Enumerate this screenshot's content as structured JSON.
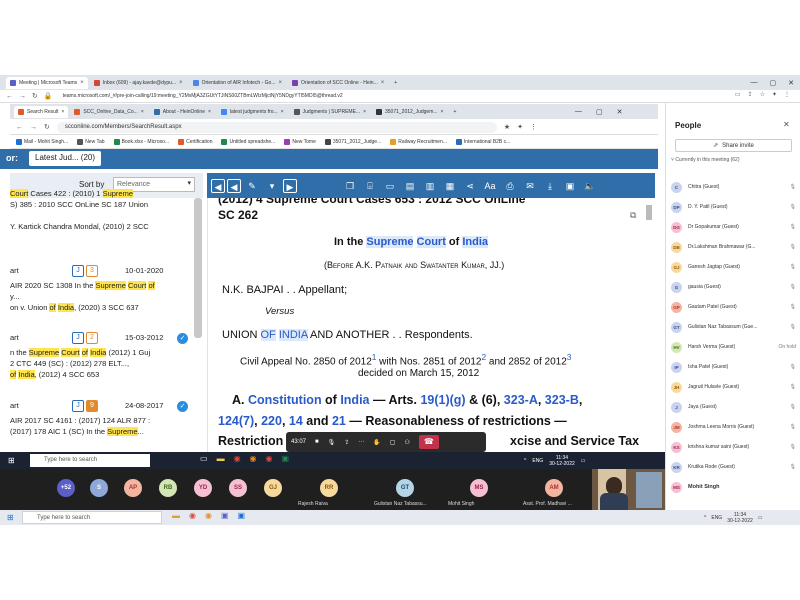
{
  "outer_tabs": [
    {
      "label": "Meeting | Microsoft Teams",
      "color": "#5b5fc7",
      "active": true
    },
    {
      "label": "Inbox (609) - ajay.kavde@dypu...",
      "color": "#d44638"
    },
    {
      "label": "Orientation of AIR Infotech - Go...",
      "color": "#4a86e8"
    },
    {
      "label": "Orientation of SCC Online - Hein...",
      "color": "#7b3fb0"
    }
  ],
  "outer_url": "teams.microsoft.com/_#/pre-join-calling/19:meeting_Y2MxMjA3ZGUtYTJiNS00ZTBmLWIzMjctNjY5NDgyYTI5MDI5@thread.v2",
  "inner_tabs": [
    {
      "label": "Search Result",
      "color": "#e05a2b",
      "active": true
    },
    {
      "label": "SCC_Online_Data_Co...",
      "color": "#e05a2b"
    },
    {
      "label": "About - HeinOnline",
      "color": "#2f6ea9"
    },
    {
      "label": "latest judgments fro...",
      "color": "#4285f4"
    },
    {
      "label": "Judgments | SUPREME...",
      "color": "#555"
    },
    {
      "label": "35071_2012_Judgem...",
      "color": "#333"
    }
  ],
  "inner_url": "scconline.com/Members/SearchResult.aspx",
  "bookmarks": [
    "Mail - Mohit Singh...",
    "New Tab",
    "Book.xlsx - Microso...",
    "Certification",
    "Untitled spreadshe...",
    "New Tome",
    "35071_2012_Judge...",
    "Railway Recruitmen...",
    "International B2B c..."
  ],
  "scc": {
    "for_label": "or:",
    "latest_label": "Latest Jud... (20)",
    "sort_by": "Sort by",
    "sort_value": "Relevance"
  },
  "left_results": [
    {
      "lines": [
        "Court Cases 422 : (2010) 1 Supreme",
        "S) 385 : 2010 SCC OnLine SC 187 Union",
        "",
        "Y. Kartick Chandra Mondal, (2010) 2 SCC"
      ]
    },
    {
      "prefix": "art",
      "a": "J",
      "b": "3",
      "date": "10-01-2020",
      "lines": [
        "AIR 2020 SC 1308 In the Supreme Court of",
        "y...",
        "on v. Union of India, (2020) 3 SCC 637"
      ]
    },
    {
      "prefix": "art",
      "a": "J",
      "b": "2",
      "date": "15-03-2012",
      "lines": [
        "n the Supreme Court of India (2012) 1 Guj",
        "2 CTC 449 (SC) : (2012) 278 ELT...,",
        "of India, (2012) 4 SCC 653"
      ]
    },
    {
      "prefix": "art",
      "a": "J",
      "b": "9",
      "date": "24-08-2017",
      "lines": [
        "AIR 2017 SC 4161 : (2017) 124 ALR 877 :",
        "(2017) 178 AIC 1 (SC) In the Supreme..."
      ]
    }
  ],
  "doc": {
    "citation_top": "(2012) 4 Supreme Court Cases 653 : 2012 SCC OnLine",
    "citation_sc": "SC 262",
    "court": "In the Supreme Court of India",
    "bench": "(Before A.K. Patnaik and Swatanter Kumar, JJ.)",
    "appellant": "N.K. BAJPAI . . Appellant;",
    "versus": "Versus",
    "respondent": "UNION OF INDIA AND ANOTHER . . Respondents.",
    "appeal1": "Civil Appeal No. 2850 of 2012",
    "appeal1b": " with Nos. 2851 of 2012",
    "appeal1c": " and 2852 of 2012",
    "appeal2": "decided on March 15, 2012",
    "head1": "A. Constitution of India — Arts. 19(1)(g) & (6), 323-A, 323-B,",
    "head2": "124(7), 220, 14 and 21 — Reasonableness of restrictions —",
    "head3a": "Restriction",
    "head3b": "xcise and Service Tax"
  },
  "meeting_bar": {
    "time": "43:07"
  },
  "inner_taskbar": {
    "search": "Type here to search",
    "lang": "ENG",
    "time": "11:34",
    "date": "30-12-2022"
  },
  "participants_strip": [
    {
      "initials": "+52",
      "bg": "#5b5fc7",
      "fg": "#fff"
    },
    {
      "initials": "S",
      "bg": "#8fa8d8",
      "fg": "#fff"
    },
    {
      "initials": "AP",
      "bg": "#f4b5a0",
      "fg": "#a33"
    },
    {
      "initials": "RB",
      "bg": "#d4e6b5",
      "fg": "#3a6a1a"
    },
    {
      "initials": "YD",
      "bg": "#f4c0d2",
      "fg": "#a02050"
    },
    {
      "initials": "SS",
      "bg": "#f4c0d2",
      "fg": "#a02050"
    },
    {
      "initials": "GJ",
      "bg": "#f7d9a0",
      "fg": "#8a5a00"
    }
  ],
  "named_participants": [
    {
      "initials": "RR",
      "bg": "#f7d9a0",
      "fg": "#8a5a00",
      "name": "Rajesh Raiva"
    },
    {
      "initials": "GT",
      "bg": "#b5d4e6",
      "fg": "#1a4a6a",
      "name": "Gulistan Naz Tabassu..."
    },
    {
      "initials": "MS",
      "bg": "#f4c0d2",
      "fg": "#a02050",
      "name": "Mohit Singh"
    },
    {
      "initials": "AM",
      "bg": "#f4b5a0",
      "fg": "#a33",
      "name": "Asst. Prof. Madhavi ..."
    }
  ],
  "outer_taskbar": {
    "search": "Type here to search",
    "lang": "ENG",
    "time": "11:34",
    "date": "30-12-2022"
  },
  "people_panel": {
    "title": "People",
    "share": "Share invite",
    "section": "Currently in this meeting (62)",
    "people": [
      {
        "initials": "C",
        "name": "Chitra (Guest)",
        "bg": "#c9d3ee",
        "fg": "#3a4a8a"
      },
      {
        "initials": "DP",
        "name": "D. Y. Patil (Guest)",
        "bg": "#c9d3ee",
        "fg": "#3a4a8a"
      },
      {
        "initials": "DG",
        "name": "Dr Gopakumar (Guest)",
        "bg": "#f4c0d2",
        "fg": "#a02050"
      },
      {
        "initials": "DB",
        "name": "Dr.Lakshman Brahmawar (G...",
        "bg": "#f7d9a0",
        "fg": "#8a5a00"
      },
      {
        "initials": "GJ",
        "name": "Ganesh Jagtap (Guest)",
        "bg": "#f7d9a0",
        "fg": "#8a5a00"
      },
      {
        "initials": "G",
        "name": "gausia (Guest)",
        "bg": "#c9d3ee",
        "fg": "#3a4a8a"
      },
      {
        "initials": "GP",
        "name": "Gautam Patel (Guest)",
        "bg": "#f4b5a0",
        "fg": "#a33"
      },
      {
        "initials": "GT",
        "name": "Gulistan Naz Tabassum (Gue...",
        "bg": "#c9d3ee",
        "fg": "#3a4a8a"
      },
      {
        "initials": "HV",
        "name": "Harsh Verma (Guest)",
        "bg": "#d4e6b5",
        "fg": "#3a6a1a",
        "status": "On hold"
      },
      {
        "initials": "IP",
        "name": "Isha Patel (Guest)",
        "bg": "#c9d3ee",
        "fg": "#3a4a8a"
      },
      {
        "initials": "JH",
        "name": "Jagruti Hulavle (Guest)",
        "bg": "#f7d9a0",
        "fg": "#8a5a00"
      },
      {
        "initials": "J",
        "name": "Jaya (Guest)",
        "bg": "#c9d3ee",
        "fg": "#3a4a8a"
      },
      {
        "initials": "JM",
        "name": "Joshma Leena Morris (Guest)",
        "bg": "#f4b5a0",
        "fg": "#a33"
      },
      {
        "initials": "KS",
        "name": "krishna kumar saini (Guest)",
        "bg": "#f4c0d2",
        "fg": "#a02050"
      },
      {
        "initials": "KR",
        "name": "Krutika Rode (Guest)",
        "bg": "#c9d3ee",
        "fg": "#3a4a8a"
      },
      {
        "initials": "MS",
        "name": "Mohit Singh",
        "bg": "#f4c0d2",
        "fg": "#a02050",
        "bold": true
      }
    ]
  }
}
